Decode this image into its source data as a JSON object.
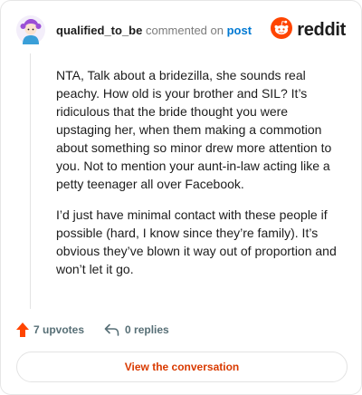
{
  "header": {
    "username": "qualified_to_be",
    "action_text": "commented on",
    "link_text": "post"
  },
  "brand": {
    "wordmark": "reddit",
    "icon": "reddit-snoo-icon",
    "color": "#ff4500"
  },
  "avatar": {
    "icon": "avatar-icon",
    "hair_color": "#9b4fd6"
  },
  "comment": {
    "paragraphs": [
      "NTA, Talk about a bridezilla, she sounds real peachy. How old is your brother and SIL? It’s ridiculous that the bride thought you were upstaging her, when them making a commotion about something so minor drew more attention to you. Not to mention your aunt-in-law acting like a petty teenager all over Facebook.",
      "I’d just have minimal contact with these people if possible (hard, I know since they’re family). It’s obvious they’ve blown it way out of proportion and won’t let it go."
    ]
  },
  "actions": {
    "upvotes_label": "7 upvotes",
    "upvote_icon": "upvote-arrow-icon",
    "upvote_color": "#ff4500",
    "replies_label": "0 replies",
    "reply_icon": "reply-arrow-icon"
  },
  "cta": {
    "label": "View the conversation",
    "color": "#d93a00"
  }
}
